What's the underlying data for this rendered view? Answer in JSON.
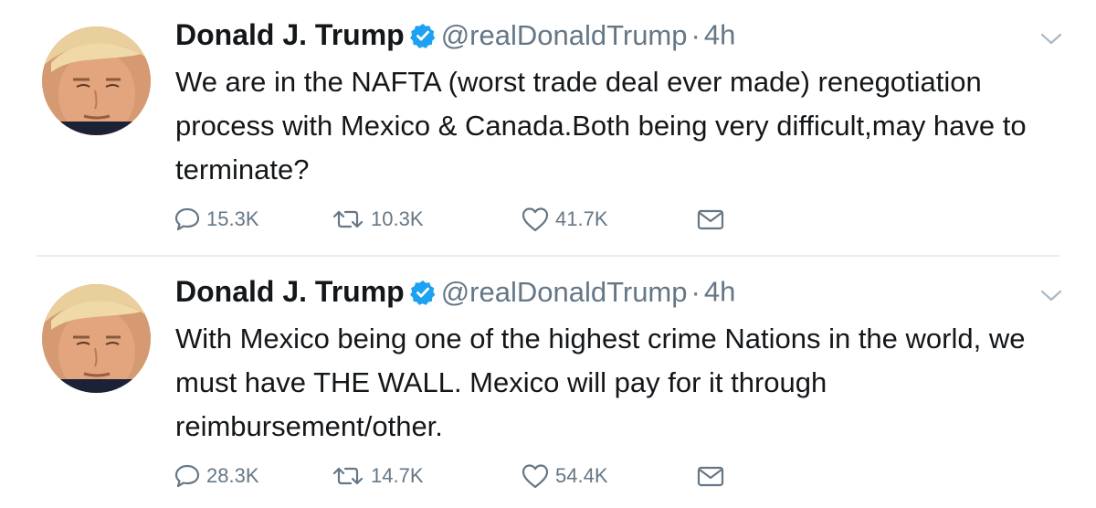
{
  "tweets": [
    {
      "author_name": "Donald J. Trump",
      "handle": "@realDonaldTrump",
      "separator": "·",
      "time": "4h",
      "text": "We are in the NAFTA (worst trade deal ever made) renegotiation process with Mexico & Canada.Both being very difficult,may have to terminate?",
      "replies": "15.3K",
      "retweets": "10.3K",
      "likes": "41.7K"
    },
    {
      "author_name": "Donald J. Trump",
      "handle": "@realDonaldTrump",
      "separator": "·",
      "time": "4h",
      "text": "With Mexico being one of the highest crime Nations in the world, we must have THE WALL. Mexico will pay for it through reimbursement/other.",
      "replies": "28.3K",
      "retweets": "14.7K",
      "likes": "54.4K"
    }
  ],
  "icons": {
    "verified": "verified-badge-icon",
    "caret": "chevron-down-icon",
    "reply": "reply-icon",
    "retweet": "retweet-icon",
    "like": "heart-icon",
    "dm": "envelope-icon"
  },
  "colors": {
    "verified": "#1da1f2",
    "meta": "#657786",
    "text": "#14171a",
    "divider": "#e6ecf0"
  }
}
